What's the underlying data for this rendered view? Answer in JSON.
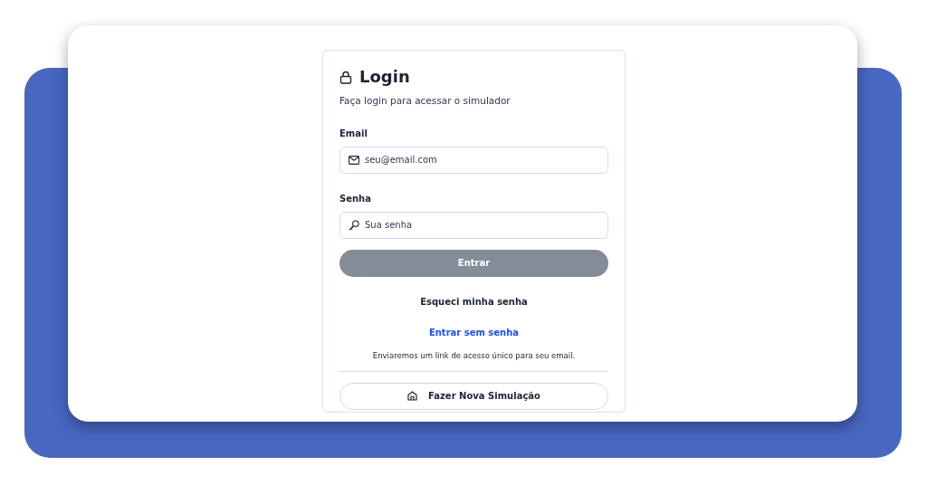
{
  "login": {
    "title": "Login",
    "subtitle": "Faça login para acessar o simulador",
    "fields": [
      {
        "label": "Email",
        "placeholder": "seu@email.com",
        "kind": "email"
      },
      {
        "label": "Senha",
        "placeholder": "Sua senha",
        "kind": "password"
      }
    ],
    "submit": {
      "label": "Entrar",
      "disabled": true
    },
    "forgot_link": "Esqueci minha senha",
    "magic_link": "Entrar sem senha",
    "magic_note": "Enviaremos um link de acesso único para seu email.",
    "new_simulation_button": "Fazer Nova Simulação"
  }
}
